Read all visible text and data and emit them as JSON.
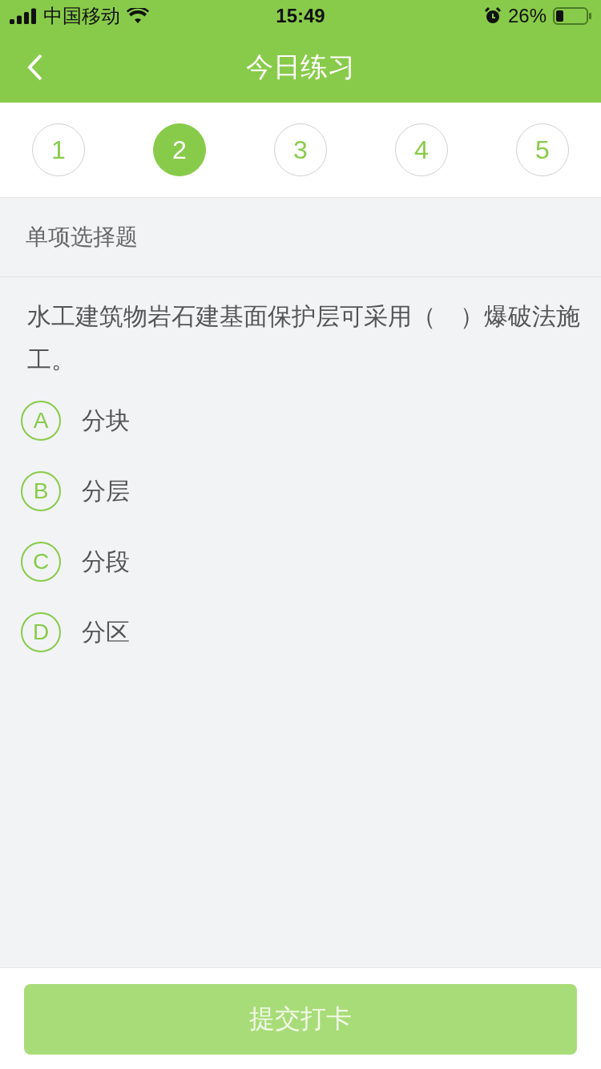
{
  "status_bar": {
    "carrier": "中国移动",
    "time": "15:49",
    "battery": "26%"
  },
  "header": {
    "title": "今日练习"
  },
  "question_tabs": [
    {
      "label": "1",
      "selected": false
    },
    {
      "label": "2",
      "selected": true
    },
    {
      "label": "3",
      "selected": false
    },
    {
      "label": "4",
      "selected": false
    },
    {
      "label": "5",
      "selected": false
    }
  ],
  "section_title": "单项选择题",
  "question": "水工建筑物岩石建基面保护层可采用（　）爆破法施工。",
  "options": [
    {
      "letter": "A",
      "text": "分块",
      "selected": false
    },
    {
      "letter": "B",
      "text": "分层",
      "selected": false
    },
    {
      "letter": "C",
      "text": "分段",
      "selected": false
    },
    {
      "letter": "D",
      "text": "分区",
      "selected": false
    }
  ],
  "submit_button": {
    "label": "提交打卡",
    "disabled": true
  }
}
